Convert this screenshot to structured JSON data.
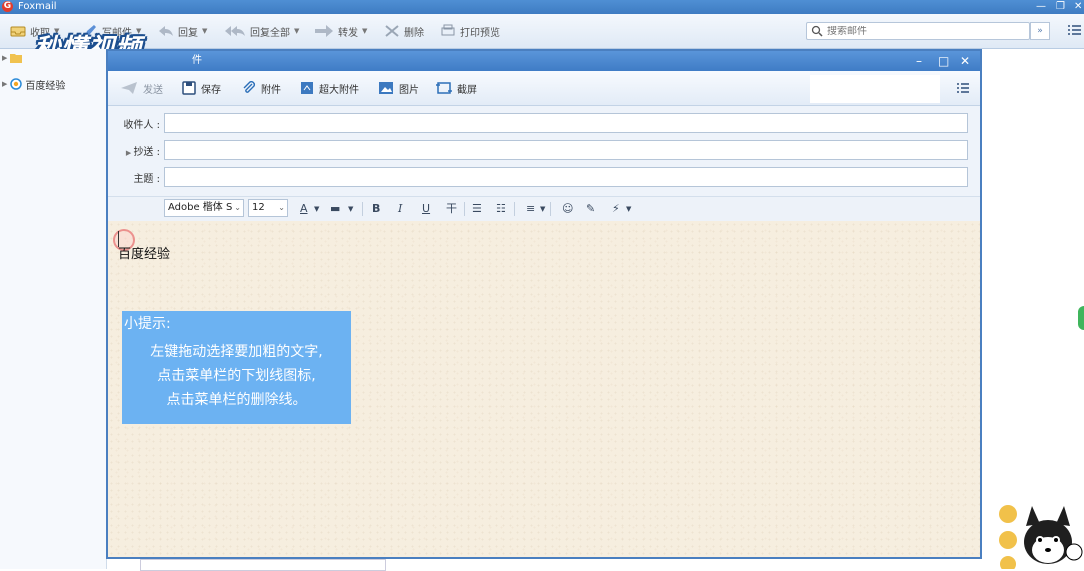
{
  "app": {
    "title": "Foxmail",
    "logo_letter": "G"
  },
  "toolbar": {
    "receive": "收取",
    "compose": "写邮件",
    "reply": "回复",
    "reply_all": "回复全部",
    "forward": "转发",
    "delete": "删除",
    "print_preview": "打印预览"
  },
  "search": {
    "placeholder": "搜索邮件"
  },
  "watermark": "秒懂视频",
  "sidebar": {
    "items": [
      {
        "label": "百度经验"
      }
    ]
  },
  "compose_window": {
    "title_partial": "件",
    "toolbar": {
      "send": "发送",
      "save": "保存",
      "attach": "附件",
      "big_attach": "超大附件",
      "image": "图片",
      "screenshot": "截屏"
    },
    "fields": {
      "to_label": "收件人 :",
      "cc_label": "抄送 :",
      "subject_label": "主题 :",
      "to_value": "",
      "cc_value": "",
      "subject_value": ""
    },
    "format": {
      "font": "Adobe 楷体 S",
      "size": "12",
      "bold": "B",
      "italic": "I",
      "underline": "U",
      "strike": "干"
    },
    "body_text": "百度经验"
  },
  "tip": {
    "title": "小提示:",
    "lines": [
      "左键拖动选择要加粗的文字,",
      "点击菜单栏的下划线图标,",
      "点击菜单栏的删除线。"
    ]
  },
  "colors": {
    "accent": "#3f7cc6",
    "tip_bg": "#6cb2f2",
    "editor_bg": "#f6eedf"
  }
}
